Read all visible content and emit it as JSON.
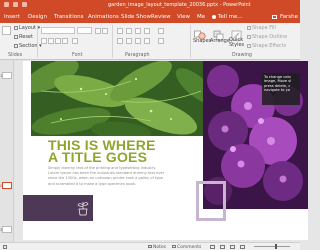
{
  "window": {
    "title": "garden_image_layout_template_20036.pptx - PowerPoint"
  },
  "tabs": {
    "active": "Home",
    "items": [
      {
        "label": "Insert"
      },
      {
        "label": "Design"
      },
      {
        "label": "Transitions"
      },
      {
        "label": "Animations"
      },
      {
        "label": "Slide Show"
      },
      {
        "label": "Review"
      },
      {
        "label": "View"
      },
      {
        "label": "Me"
      },
      {
        "label": "Tell me..."
      }
    ],
    "user": "Farshe"
  },
  "ribbon": {
    "slides_group": {
      "layout_label": "Layout",
      "reset_label": "Reset",
      "section_label": "Section",
      "group_label": "Slides"
    },
    "font_group": {
      "font_value": "",
      "size_value": "",
      "group_label": "Font"
    },
    "paragraph_group": {
      "group_label": "Paragraph"
    },
    "drawing_group": {
      "shapes_label": "Shapes",
      "arrange_label": "Arrange",
      "quick_styles_label": "Quick Styles",
      "shape_fill_label": "Shape Fill",
      "shape_outline_label": "Shape Outline",
      "shape_effects_label": "Shape Effects",
      "group_label": "Drawing"
    }
  },
  "thumbnails": {
    "items": [
      {
        "num": "1"
      },
      {
        "num": "2"
      },
      {
        "num": "3"
      }
    ]
  },
  "slide": {
    "headline_line1": "THIS IS WHERE",
    "headline_line2": "A TITLE GOES",
    "body_lines": [
      "Simply dummy text of the printing and typesetting industry.",
      "Lorem Ipsum has been the industries standard dummy text ever",
      "since the 1500s, when an unknown printer took a galley of type",
      "and scrambled it to make a type specimen book."
    ],
    "popup_lines": [
      "To change colo",
      "image, Move sl",
      "press delete, c",
      "navigate to yo"
    ]
  },
  "statusbar": {
    "notes": "Notes",
    "comments": "Comments"
  },
  "colors": {
    "accent": "#d04a27",
    "headline": "#8fa62d",
    "purple_box": "#4d3856"
  }
}
